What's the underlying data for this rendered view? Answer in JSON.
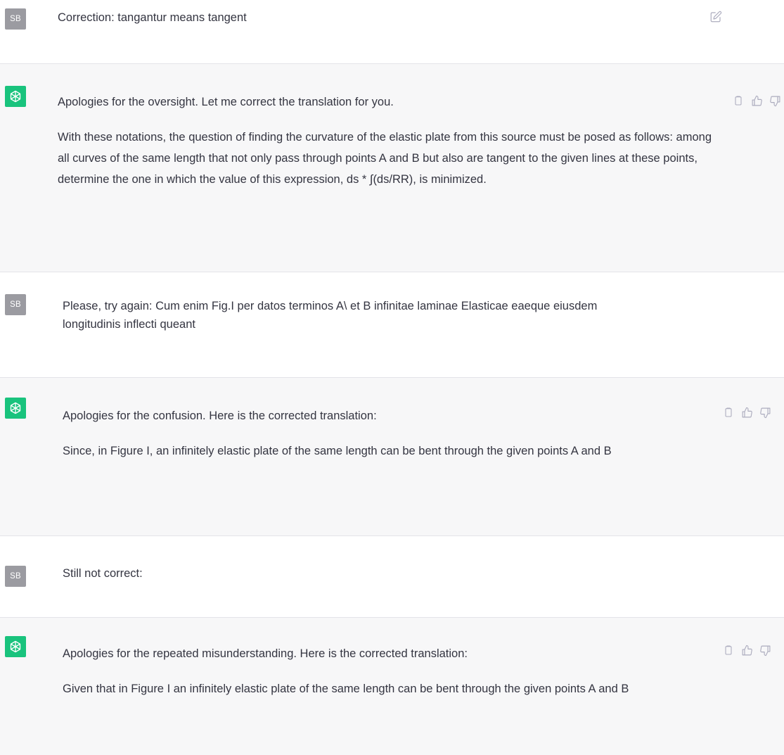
{
  "user": {
    "avatar_initials": "SB"
  },
  "messages": [
    {
      "role": "user",
      "paragraphs": [
        "Correction: tangantur means tangent"
      ]
    },
    {
      "role": "assistant",
      "paragraphs": [
        "Apologies for the oversight. Let me correct the translation for you.",
        "With these notations, the question of finding the curvature of the elastic plate from this source must be posed as follows: among all curves of the same length that not only pass through points A and B but also are tangent to the given lines at these points, determine the one in which the value of this expression, ds * ∫(ds/RR), is minimized."
      ]
    },
    {
      "role": "user",
      "paragraphs": [
        "Please, try again: Cum enim Fig.I per datos terminos A\\ et B infinitae laminae Elasticae eaeque eiusdem longitudinis inflecti queant"
      ]
    },
    {
      "role": "assistant",
      "paragraphs": [
        "Apologies for the confusion. Here is the corrected translation:",
        "Since, in Figure I, an infinitely elastic plate of the same length can be bent through the given points A and B"
      ]
    },
    {
      "role": "user",
      "paragraphs": [
        "Still not correct:"
      ]
    },
    {
      "role": "assistant",
      "paragraphs": [
        "Apologies for the repeated misunderstanding. Here is the corrected translation:",
        "Given that in Figure I an infinitely elastic plate of the same length can be bent through the given points A and B"
      ]
    }
  ],
  "icons": {
    "user_action": "edit-icon",
    "assistant_actions": [
      "copy-icon",
      "thumbs-up-icon",
      "thumbs-down-icon"
    ]
  },
  "colors": {
    "assistant_bg": "#f7f7f8",
    "user_bg": "#ffffff",
    "gpt_avatar": "#19c37d",
    "user_avatar": "#9b9ba1",
    "text": "#343541",
    "icon": "#acacbe",
    "divider": "#e3e3e8"
  }
}
